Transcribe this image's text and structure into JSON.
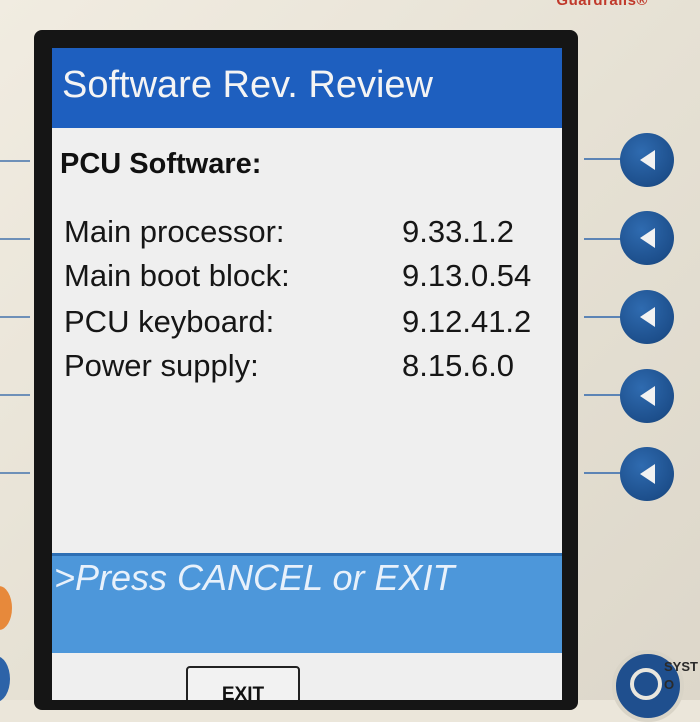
{
  "device": {
    "brand_text": "Guardrails®",
    "system_label_line1": "SYST",
    "system_label_line2": "O"
  },
  "screen": {
    "title": "Software Rev. Review",
    "section_heading": "PCU Software:",
    "rows": [
      {
        "label": "Main processor:",
        "value": "9.33.1.2"
      },
      {
        "label": "Main boot block:",
        "value": "9.13.0.54"
      },
      {
        "label": "PCU keyboard:",
        "value": "9.12.41.2"
      },
      {
        "label": "Power supply:",
        "value": "8.15.6.0"
      }
    ],
    "prompt": ">Press CANCEL or EXIT",
    "softkeys": {
      "exit_label": "EXIT"
    }
  },
  "colors": {
    "title_bar": "#1e5fbf",
    "prompt_bar": "#4d97da",
    "sidekey": "#1d4f8c"
  },
  "icons": {
    "sidekey": "triangle-left-icon",
    "system_button": "power-ring-icon"
  }
}
